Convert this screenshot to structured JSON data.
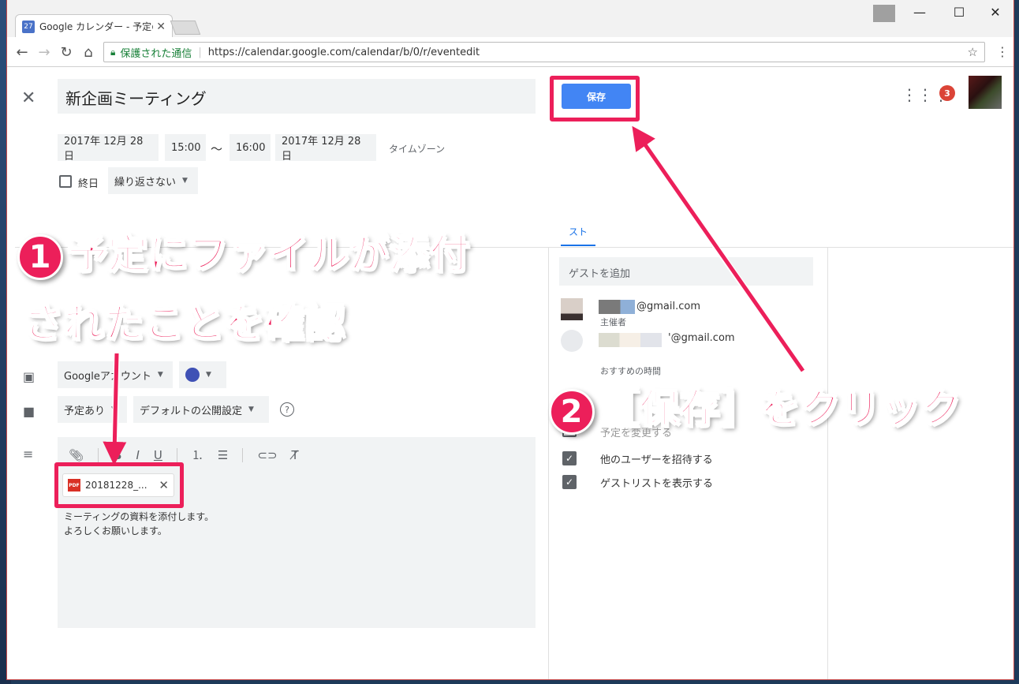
{
  "browser": {
    "tab_title": "Google カレンダー - 予定の",
    "tab_favicon": "27",
    "secure_label": "保護された通信",
    "url": "https://calendar.google.com/calendar/b/0/r/eventedit"
  },
  "event": {
    "title": "新企画ミーティング",
    "save_label": "保存",
    "start_date": "2017年 12月 28日",
    "start_time": "15:00",
    "tilde": "〜",
    "end_time": "16:00",
    "end_date": "2017年 12月 28日",
    "timezone_label": "タイムゾーン",
    "allday_label": "終日",
    "repeat_label": "繰り返さない",
    "notification_count": "3"
  },
  "details": {
    "calendar_label": "Googleアカウント",
    "busy_label": "予定あり",
    "visibility_label": "デフォルトの公開設定",
    "attachment_name": "20181228_...",
    "description_line1": "ミーティングの資料を添付します。",
    "description_line2": "よろしくお願いします。"
  },
  "guests": {
    "tab_partial": "スト",
    "add_placeholder": "ゲストを追加",
    "guest1_suffix": "@gmail.com",
    "organizer_label": "主催者",
    "guest2_suffix": "'@gmail.com",
    "suggested_label": "おすすめの時間",
    "perm_invite": "他のユーザーを招待する",
    "perm_list": "ゲストリストを表示する",
    "partial_label": "予定を変更する"
  },
  "annotations": {
    "callout1_num": "❶",
    "callout1_line1": "予定にファイルが添付",
    "callout1_line2": "されたことを確認",
    "callout2_num": "❷",
    "callout2_text": "［保存］をクリック"
  },
  "colors": {
    "accent": "#ec1f5a",
    "save_blue": "#4285f4",
    "event_color": "#3f51b5"
  }
}
